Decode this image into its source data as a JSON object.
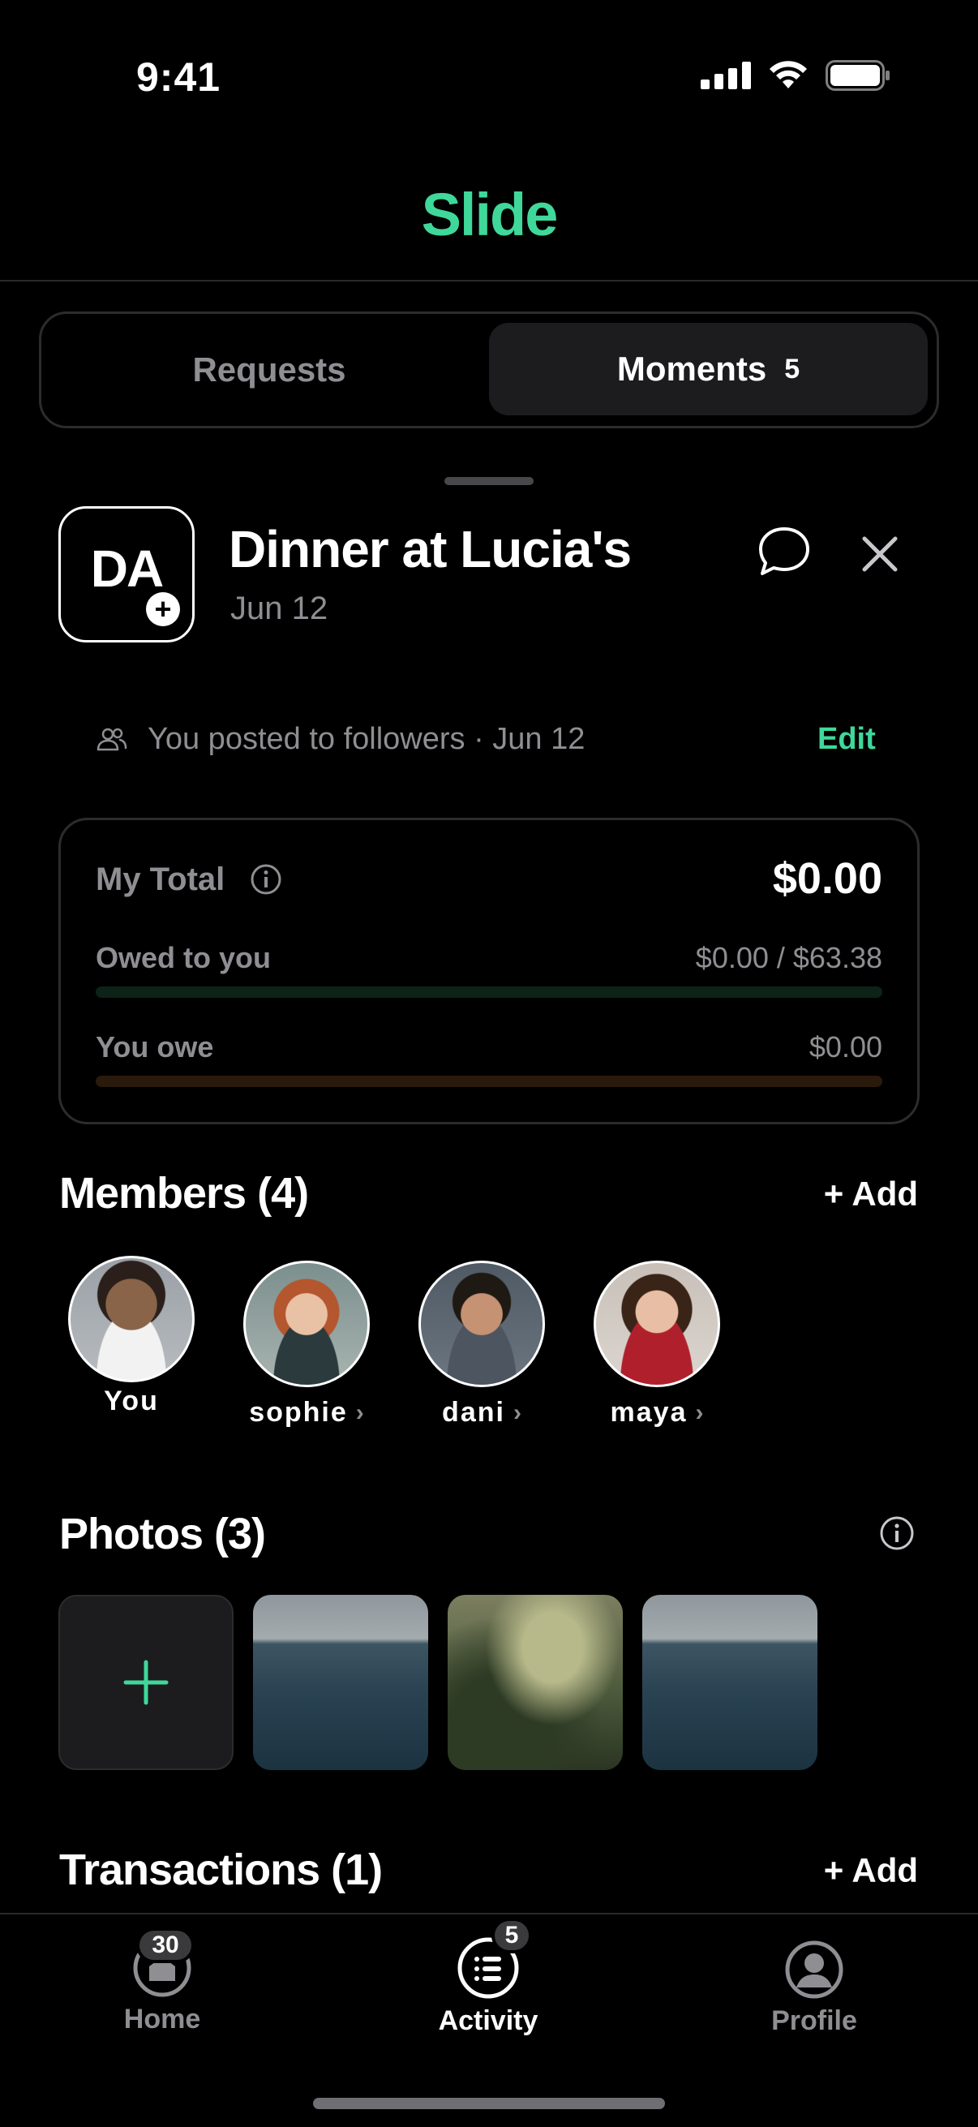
{
  "status_bar": {
    "time": "9:41"
  },
  "header": {
    "app_name": "Slide"
  },
  "segmented": {
    "requests_label": "Requests",
    "moments_label": "Moments",
    "moments_count": "5"
  },
  "moment": {
    "initials": "DA",
    "title": "Dinner at Lucia's",
    "date": "Jun 12",
    "posted_text": "You posted to followers · Jun 12",
    "edit_label": "Edit"
  },
  "totals": {
    "my_total_label": "My Total",
    "my_total_value": "$0.00",
    "owed_label": "Owed to you",
    "owed_value": "$0.00 / $63.38",
    "owed_progress": 0,
    "owe_label": "You owe",
    "owe_value": "$0.00",
    "owe_progress": 0
  },
  "members": {
    "title": "Members (4)",
    "add_label": "+ Add",
    "items": [
      {
        "name": "You",
        "has_chevron": false
      },
      {
        "name": "sophie",
        "has_chevron": true
      },
      {
        "name": "dani",
        "has_chevron": true
      },
      {
        "name": "maya",
        "has_chevron": true
      }
    ]
  },
  "photos": {
    "title": "Photos (3)",
    "items": [
      "ocean-photo",
      "forest-photo",
      "ocean-photo"
    ]
  },
  "transactions": {
    "title": "Transactions (1)",
    "add_label": "+ Add"
  },
  "tabbar": {
    "home_label": "Home",
    "home_badge": "30",
    "activity_label": "Activity",
    "activity_badge": "5",
    "profile_label": "Profile"
  },
  "colors": {
    "accent": "#3fd89a",
    "muted": "#8e8e93",
    "background": "#000000"
  }
}
